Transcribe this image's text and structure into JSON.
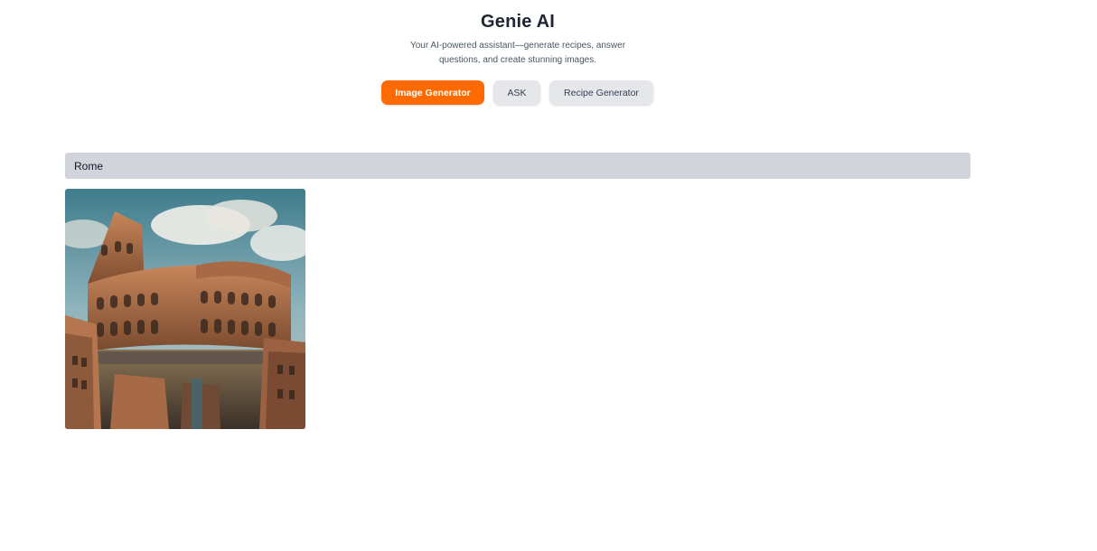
{
  "header": {
    "title": "Genie AI",
    "subtitle": "Your AI-powered assistant—generate recipes, answer questions, and create stunning images."
  },
  "tabs": [
    {
      "label": "Image Generator",
      "active": true
    },
    {
      "label": "ASK",
      "active": false
    },
    {
      "label": "Recipe Generator",
      "active": false
    }
  ],
  "prompt": {
    "value": "Rome"
  },
  "result": {
    "image_subject": "colosseum-image"
  },
  "colors": {
    "accent": "#ff6a00",
    "tab_inactive": "#e5e7eb",
    "input_bg": "#d1d5db",
    "title": "#1e2533"
  }
}
